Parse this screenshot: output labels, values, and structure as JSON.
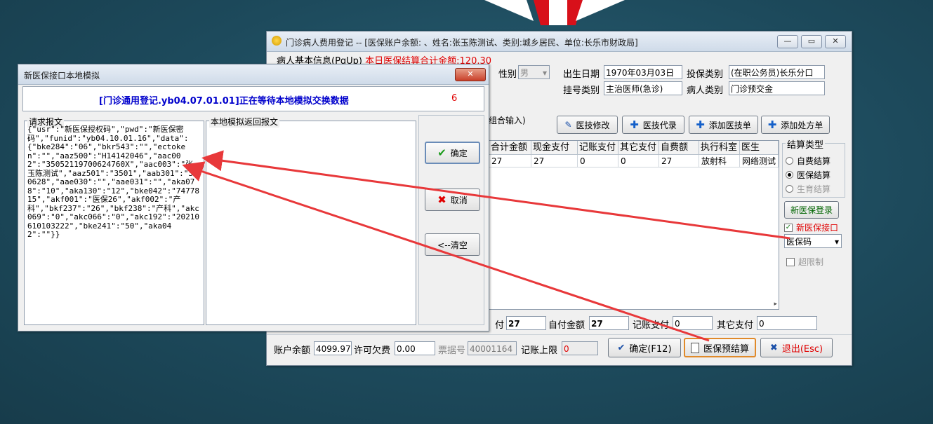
{
  "main_window": {
    "title": "门诊病人费用登记 -- [医保账户余额: 、姓名:张玉陈测试、类别:城乡居民、单位:长乐市财政局]",
    "patient_info_label": "病人基本信息(PgUp)",
    "settle_total": "本日医保结算合计金额:120.30",
    "gender_label": "性别",
    "gender_value": "男",
    "birth_label": "出生日期",
    "birth_value": "1970年03月03日",
    "insure_type_label": "投保类别",
    "insure_type_value": "(在职公务员)长乐分口",
    "register_type_label": "挂号类别",
    "register_type_value": "主治医师(急诊)",
    "patient_type_label": "病人类别",
    "patient_type_value": "门诊预交金",
    "combo_input_hint": "组合输入)",
    "toolbar": {
      "tech_edit": "医技修改",
      "tech_proxy": "医技代录",
      "add_tech": "添加医技单",
      "add_rx": "添加处方单"
    },
    "grid_headers": [
      "合计金额",
      "现金支付",
      "记账支付",
      "其它支付",
      "自费额",
      "执行科室",
      "医生"
    ],
    "grid_rows": [
      [
        "27",
        "27",
        "0",
        "0",
        "27",
        "放射科",
        "网络测试"
      ]
    ],
    "settle_type_title": "结算类型",
    "settle_types": [
      "自费结算",
      "医保结算",
      "生育结算"
    ],
    "new_insure_login": "新医保登录",
    "new_insure_port": "新医保接口",
    "dropdown_value": "医保码",
    "over_limit": "超限制",
    "totals": {
      "pay_label": "付",
      "pay_value": "27",
      "self_pay_label": "自付金额",
      "self_pay_value": "27",
      "account_pay_label": "记账支付",
      "account_pay_value": "0",
      "other_pay_label": "其它支付",
      "other_pay_value": "0"
    },
    "bottom": {
      "balance_label": "账户余额",
      "balance_value": "4099.97",
      "allow_debt_label": "许可欠费",
      "allow_debt_value": "0.00",
      "invoice_label": "票据号",
      "invoice_value": "40001164",
      "account_limit_label": "记账上限",
      "account_limit_value": "0",
      "confirm": "确定(F12)",
      "pre_settle": "医保预结算",
      "exit": "退出(Esc)"
    }
  },
  "dialog": {
    "title": "新医保接口本地模拟",
    "header": "[门诊通用登记.yb04.07.01.01]正在等待本地模拟交换数据",
    "counter": "6",
    "request_label": "请求报文",
    "response_label": "本地模拟返回报文",
    "request_text": "{\"usr\":\"新医保授权码\",\"pwd\":\"新医保密码\",\"funid\":\"yb04.10.01.16\",\"data\":{\"bke284\":\"06\",\"bkr543\":\"\",\"ectoken\":\"\",\"aaz500\":\"H14142046\",\"aac002\":\"35052119700624760X\",\"aac003\":\"张玉陈测试\",\"aaz501\":\"3501\",\"aab301\":\"350628\",\"aae030\":\"\",\"aae031\":\"\",\"aka078\":\"10\",\"aka130\":\"12\",\"bke042\":\"7477815\",\"akf001\":\"医保26\",\"akf002\":\"产科\",\"bkf237\":\"26\",\"bkf238\":\"产科\",\"akc069\":\"0\",\"akc066\":\"0\",\"akc192\":\"20210610103222\",\"bke241\":\"50\",\"aka042\":\"\"}}",
    "ok": "确定",
    "cancel": "取消",
    "clear": "<--清空"
  },
  "colors": {
    "accent_blue": "#0000cc",
    "alert_red": "#e00000",
    "arrow_red": "#e8383a"
  }
}
